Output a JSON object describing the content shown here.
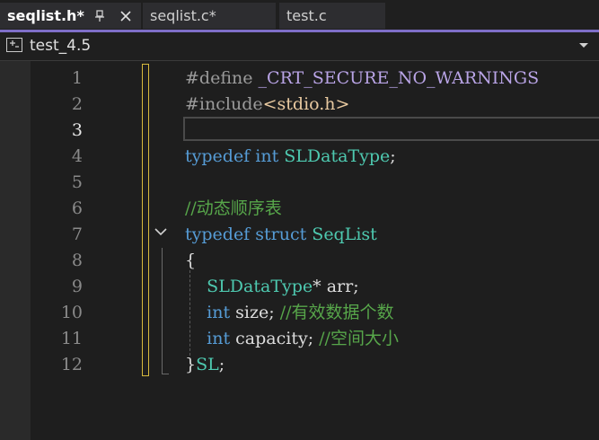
{
  "tabs": [
    {
      "label": "seqlist.h*",
      "active": true
    },
    {
      "label": "seqlist.c*",
      "active": false
    },
    {
      "label": "test.c",
      "active": false
    }
  ],
  "project": {
    "name": "test_4.5"
  },
  "editor": {
    "current_line": 3,
    "line_numbers": [
      "1",
      "2",
      "3",
      "4",
      "5",
      "6",
      "7",
      "8",
      "9",
      "10",
      "11",
      "12"
    ],
    "lines": [
      {
        "segments": [
          {
            "cls": "pp",
            "text": "#define "
          },
          {
            "cls": "macro",
            "text": "_CRT_SECURE_NO_WARNINGS"
          }
        ]
      },
      {
        "segments": [
          {
            "cls": "pp",
            "text": "#include"
          },
          {
            "cls": "str",
            "text": "<stdio.h>"
          }
        ]
      },
      {
        "segments": []
      },
      {
        "segments": [
          {
            "cls": "kw",
            "text": "typedef"
          },
          {
            "cls": "",
            "text": " "
          },
          {
            "cls": "kw",
            "text": "int"
          },
          {
            "cls": "",
            "text": " "
          },
          {
            "cls": "type",
            "text": "SLDataType"
          },
          {
            "cls": "",
            "text": ";"
          }
        ]
      },
      {
        "segments": []
      },
      {
        "segments": [
          {
            "cls": "cmt",
            "text": "//动态顺序表"
          }
        ]
      },
      {
        "segments": [
          {
            "cls": "kw",
            "text": "typedef"
          },
          {
            "cls": "",
            "text": " "
          },
          {
            "cls": "kw",
            "text": "struct"
          },
          {
            "cls": "",
            "text": " "
          },
          {
            "cls": "type",
            "text": "SeqList"
          }
        ]
      },
      {
        "segments": [
          {
            "cls": "",
            "text": "{"
          }
        ]
      },
      {
        "segments": [
          {
            "cls": "",
            "text": "    "
          },
          {
            "cls": "type",
            "text": "SLDataType"
          },
          {
            "cls": "",
            "text": "* arr;"
          }
        ]
      },
      {
        "segments": [
          {
            "cls": "",
            "text": "    "
          },
          {
            "cls": "kw",
            "text": "int"
          },
          {
            "cls": "",
            "text": " size; "
          },
          {
            "cls": "cmt",
            "text": "//有效数据个数"
          }
        ]
      },
      {
        "segments": [
          {
            "cls": "",
            "text": "    "
          },
          {
            "cls": "kw",
            "text": "int"
          },
          {
            "cls": "",
            "text": " capacity; "
          },
          {
            "cls": "cmt",
            "text": "//空间大小"
          }
        ]
      },
      {
        "segments": [
          {
            "cls": "",
            "text": "}"
          },
          {
            "cls": "type",
            "text": "SL"
          },
          {
            "cls": "",
            "text": ";"
          }
        ]
      }
    ]
  },
  "colors": {
    "accent": "#7f6fc8",
    "keyword": "#569cd6",
    "type": "#4ec9b0",
    "comment": "#57a64a",
    "change_marker": "#d7ba3d"
  }
}
